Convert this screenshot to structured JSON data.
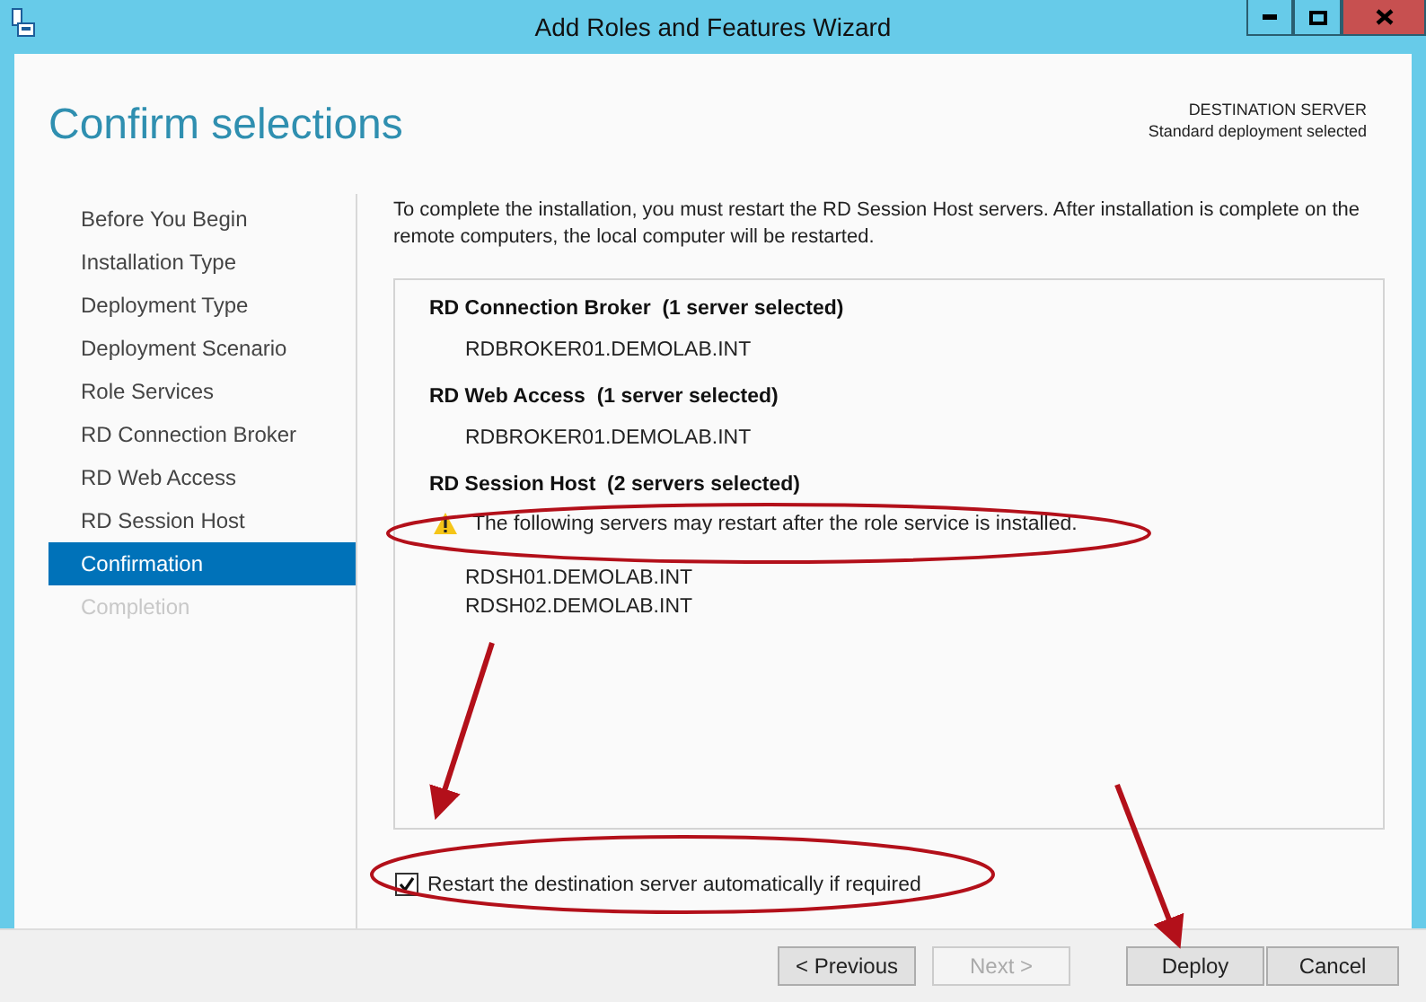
{
  "window": {
    "title": "Add Roles and Features Wizard"
  },
  "header": {
    "title": "Confirm selections",
    "destination_label": "DESTINATION SERVER",
    "destination_value": "Standard deployment selected"
  },
  "sidebar": {
    "items": [
      {
        "label": "Before You Begin",
        "selected": false,
        "disabled": false
      },
      {
        "label": "Installation Type",
        "selected": false,
        "disabled": false
      },
      {
        "label": "Deployment Type",
        "selected": false,
        "disabled": false
      },
      {
        "label": "Deployment Scenario",
        "selected": false,
        "disabled": false
      },
      {
        "label": "Role Services",
        "selected": false,
        "disabled": false
      },
      {
        "label": "RD Connection Broker",
        "selected": false,
        "disabled": false
      },
      {
        "label": "RD Web Access",
        "selected": false,
        "disabled": false
      },
      {
        "label": "RD Session Host",
        "selected": false,
        "disabled": false
      },
      {
        "label": "Confirmation",
        "selected": true,
        "disabled": false
      },
      {
        "label": "Completion",
        "selected": false,
        "disabled": true
      }
    ]
  },
  "intro": "To complete the installation, you must restart the RD Session Host servers. After installation is complete on the remote computers, the local computer will be restarted.",
  "sections": [
    {
      "role": "RD Connection Broker",
      "count": "(1 server selected)",
      "servers": [
        "RDBROKER01.DEMOLAB.INT"
      ]
    },
    {
      "role": "RD Web Access",
      "count": "(1 server selected)",
      "servers": [
        "RDBROKER01.DEMOLAB.INT"
      ]
    },
    {
      "role": "RD Session Host",
      "count": "(2 servers selected)",
      "warning": "The following servers may restart after the role service is installed.",
      "servers": [
        "RDSH01.DEMOLAB.INT",
        "RDSH02.DEMOLAB.INT"
      ]
    }
  ],
  "restart_option": {
    "label": "Restart the destination server automatically if required",
    "checked": true
  },
  "buttons": [
    {
      "label": "< Previous",
      "disabled": false
    },
    {
      "label": "Next >",
      "disabled": true
    },
    {
      "label": "Deploy",
      "disabled": false
    },
    {
      "label": "Cancel",
      "disabled": false
    }
  ]
}
